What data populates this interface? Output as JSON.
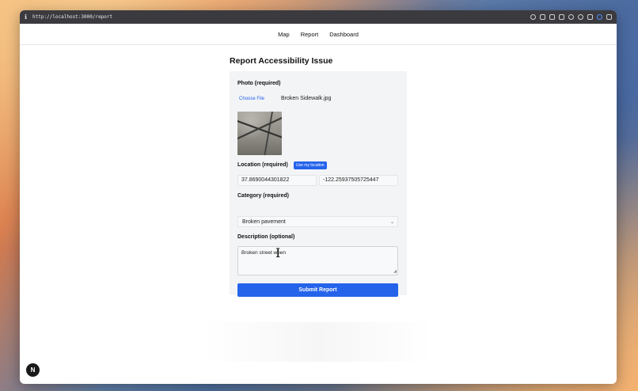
{
  "browser": {
    "url": "http://localhost:3000/report"
  },
  "nav": {
    "items": [
      "Map",
      "Report",
      "Dashboard"
    ]
  },
  "page": {
    "title": "Report Accessibility Issue"
  },
  "form": {
    "photo_label": "Photo (required)",
    "choose_file_label": "Choose File",
    "file_name": "Broken Sidewalk.jpg",
    "location_label": "Location (required)",
    "use_location_label": "Use my location",
    "latitude": "37.8690044301822",
    "longitude": "-122.25937505725447",
    "category_label": "Category (required)",
    "category_value": "Broken pavement",
    "description_label": "Description (optional)",
    "description_value": "Broken street when",
    "submit_label": "Submit Report"
  },
  "badge": {
    "letter": "N"
  },
  "colors": {
    "accent": "#2563eb",
    "card_bg": "#f3f4f6"
  }
}
